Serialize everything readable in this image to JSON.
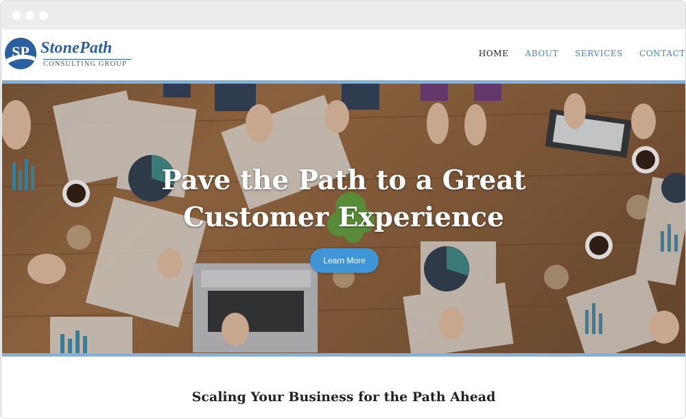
{
  "logo": {
    "initials": "SP",
    "name": "StonePath",
    "subtitle": "CONSULTING GROUP"
  },
  "nav": {
    "items": [
      {
        "label": "HOME",
        "active": true
      },
      {
        "label": "ABOUT",
        "active": false
      },
      {
        "label": "SERVICES",
        "active": false
      },
      {
        "label": "CONTACT",
        "active": false
      }
    ]
  },
  "hero": {
    "title_line1": "Pave the Path to a Great",
    "title_line2": "Customer Experience",
    "button_label": "Learn More"
  },
  "section": {
    "title": "Scaling Your Business for the Path Ahead"
  },
  "colors": {
    "accent": "#3f95d6",
    "nav_link": "#3a86c8",
    "border_blue": "#7fb3de",
    "logo_blue": "#2a5fa0"
  }
}
